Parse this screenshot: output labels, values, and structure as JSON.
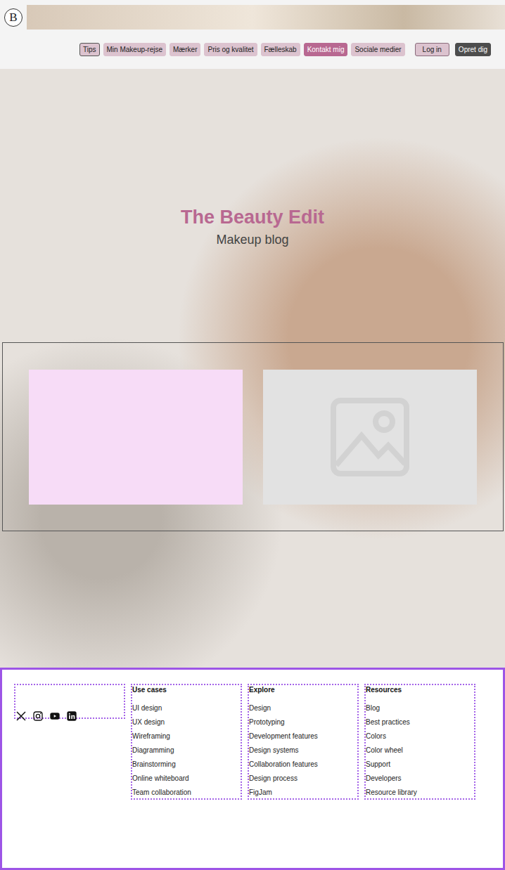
{
  "logo": "B",
  "nav": [
    {
      "label": "Tips",
      "selected": false,
      "focused": true
    },
    {
      "label": "Min Makeup-rejse",
      "selected": false,
      "focused": false
    },
    {
      "label": "Mærker",
      "selected": false,
      "focused": false
    },
    {
      "label": "Pris og kvalitet",
      "selected": false,
      "focused": false
    },
    {
      "label": "Fælleskab",
      "selected": false,
      "focused": false
    },
    {
      "label": "Kontakt mig",
      "selected": true,
      "focused": false
    },
    {
      "label": "Sociale medier",
      "selected": false,
      "focused": false
    }
  ],
  "auth": [
    {
      "label": "Log in",
      "kind": "light"
    },
    {
      "label": "Opret dig",
      "kind": "dark"
    }
  ],
  "hero": {
    "title": "The Beauty Edit",
    "subtitle": "Makeup blog"
  },
  "footer": {
    "columns": [
      {
        "title": "Use cases",
        "links": [
          "UI design",
          "UX design",
          "Wireframing",
          "Diagramming",
          "Brainstorming",
          "Online whiteboard",
          "Team collaboration"
        ]
      },
      {
        "title": "Explore",
        "links": [
          "Design",
          "Prototyping",
          "Development features",
          "Design systems",
          "Collaboration features",
          "Design process",
          "FigJam"
        ]
      },
      {
        "title": "Resources",
        "links": [
          "Blog",
          "Best practices",
          "Colors",
          "Color wheel",
          "Support",
          "Developers",
          "Resource library"
        ]
      }
    ]
  }
}
